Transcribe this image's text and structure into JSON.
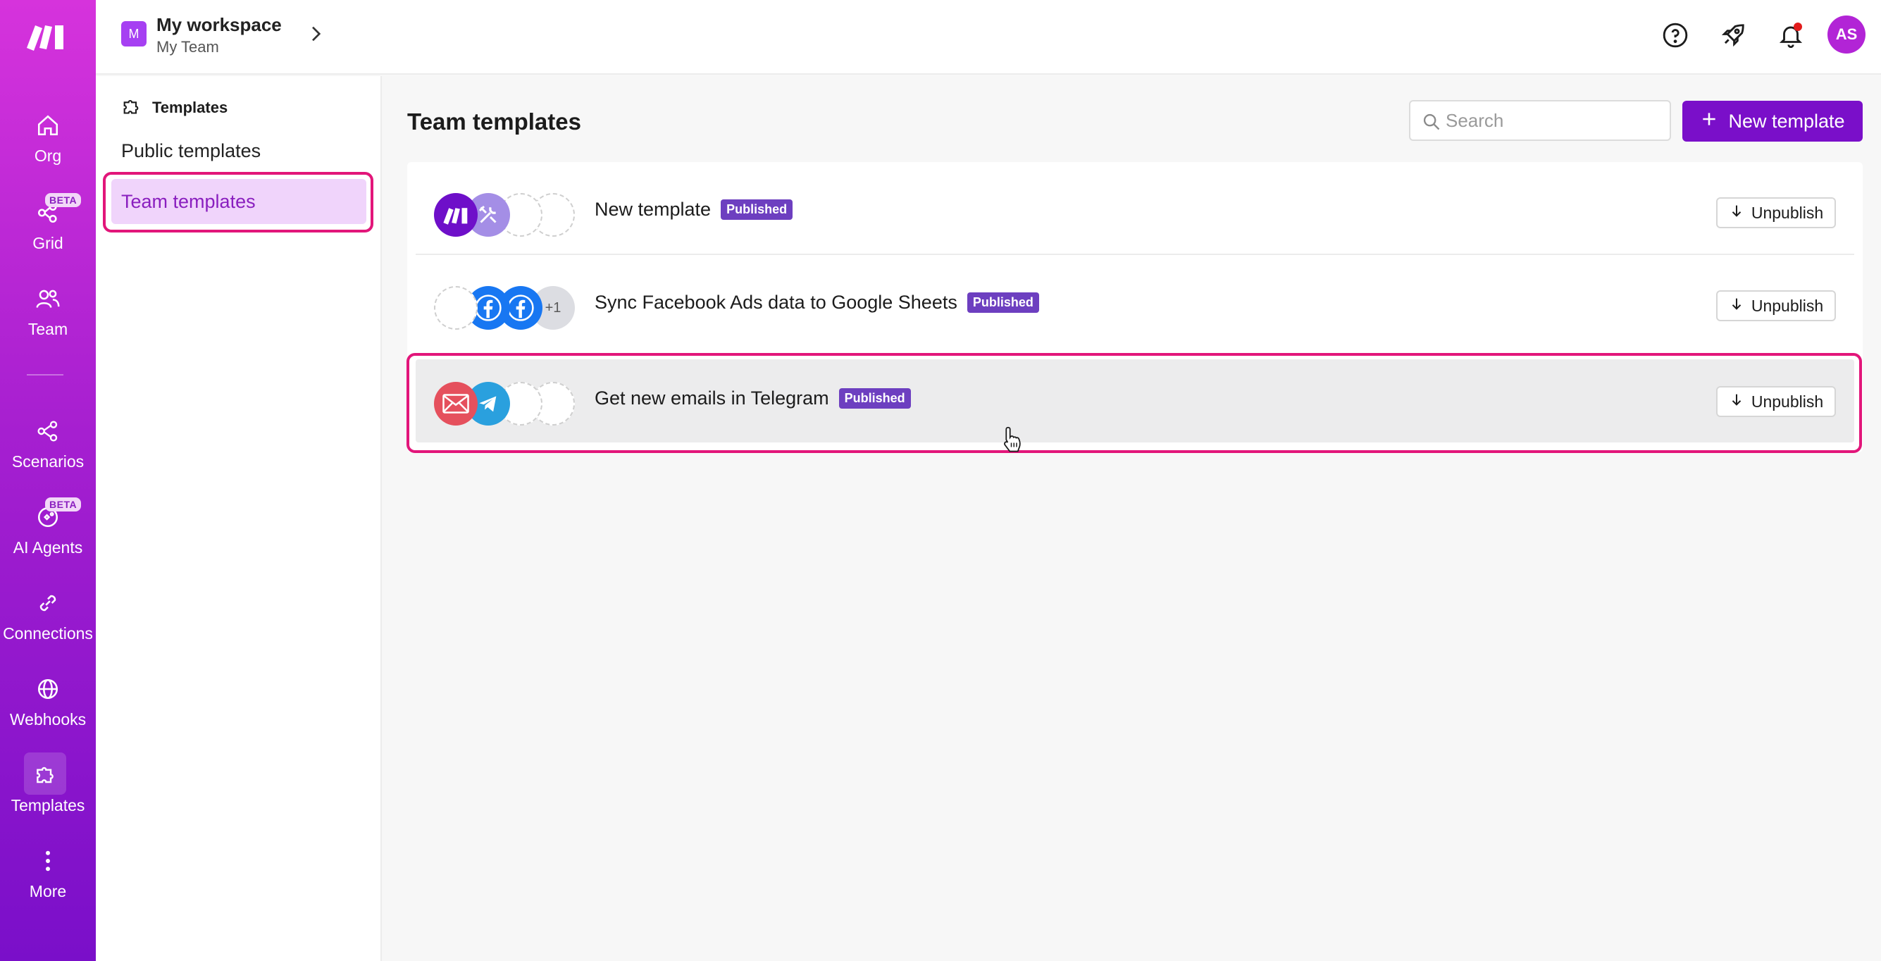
{
  "topbar": {
    "workspace_initial": "M",
    "workspace_name": "My workspace",
    "team_name": "My Team",
    "avatar_initials": "AS"
  },
  "rail": {
    "items": [
      {
        "label": "Org",
        "icon": "home-icon"
      },
      {
        "label": "Grid",
        "icon": "grid-icon",
        "beta": "BETA"
      },
      {
        "label": "Team",
        "icon": "team-icon"
      },
      {
        "label": "Scenarios",
        "icon": "scenarios-icon"
      },
      {
        "label": "AI Agents",
        "icon": "ai-agents-icon",
        "beta": "BETA"
      },
      {
        "label": "Connections",
        "icon": "connections-icon"
      },
      {
        "label": "Webhooks",
        "icon": "webhooks-icon"
      },
      {
        "label": "Templates",
        "icon": "templates-icon",
        "active": true
      },
      {
        "label": "More",
        "icon": "more-icon"
      }
    ]
  },
  "subnav": {
    "heading": "Templates",
    "links": [
      {
        "label": "Public templates"
      },
      {
        "label": "Team templates",
        "active": true
      }
    ]
  },
  "main": {
    "title": "Team templates",
    "search_placeholder": "Search",
    "new_button": "New template",
    "rows": [
      {
        "title": "New template",
        "status": "Published",
        "action": "Unpublish",
        "apps": [
          "make-app-icon",
          "tools-app-icon",
          "empty",
          "empty"
        ]
      },
      {
        "title": "Sync Facebook Ads data to Google Sheets",
        "status": "Published",
        "action": "Unpublish",
        "apps": [
          "empty",
          "facebook-app-icon",
          "facebook-app-icon",
          "+1"
        ]
      },
      {
        "title": "Get new emails in Telegram",
        "status": "Published",
        "action": "Unpublish",
        "apps": [
          "email-app-icon",
          "telegram-app-icon",
          "empty",
          "empty"
        ]
      }
    ]
  },
  "colors": {
    "brand": "#7a0fc9",
    "highlight_ring": "#e2167a",
    "badge": "#6d3fc0"
  }
}
